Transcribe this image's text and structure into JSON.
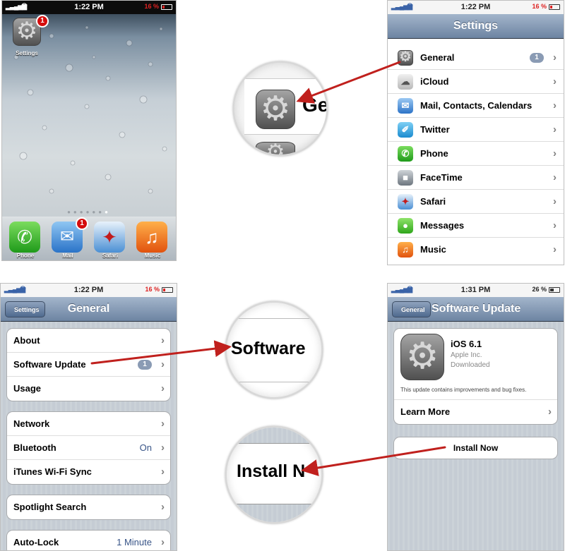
{
  "panel1": {
    "status": {
      "time": "1:22 PM",
      "battery": "16 %"
    },
    "settings_label": "Settings",
    "settings_badge": "1",
    "dock": [
      {
        "label": "Phone",
        "badge": ""
      },
      {
        "label": "Mail",
        "badge": "1"
      },
      {
        "label": "Safari",
        "badge": ""
      },
      {
        "label": "Music",
        "badge": ""
      }
    ]
  },
  "panel2": {
    "status": {
      "time": "1:22 PM",
      "battery": "16 %"
    },
    "title": "Settings",
    "rows": [
      {
        "label": "General",
        "icon": "gear-icon",
        "badge": "1"
      },
      {
        "label": "iCloud",
        "icon": "cloud-icon"
      },
      {
        "label": "Mail, Contacts, Calendars",
        "icon": "envelope-icon"
      },
      {
        "label": "Twitter",
        "icon": "twitter-bird-icon"
      },
      {
        "label": "Phone",
        "icon": "phone-icon"
      },
      {
        "label": "FaceTime",
        "icon": "camera-icon"
      },
      {
        "label": "Safari",
        "icon": "compass-icon"
      },
      {
        "label": "Messages",
        "icon": "speech-bubble-icon"
      },
      {
        "label": "Music",
        "icon": "music-note-icon"
      }
    ]
  },
  "magnifier1": {
    "text": "Ge"
  },
  "panel3": {
    "status": {
      "time": "1:22 PM",
      "battery": "16 %"
    },
    "back": "Settings",
    "title": "General",
    "groups": [
      [
        {
          "label": "About"
        },
        {
          "label": "Software Update",
          "badge": "1"
        },
        {
          "label": "Usage"
        }
      ],
      [
        {
          "label": "Network"
        },
        {
          "label": "Bluetooth",
          "value": "On"
        },
        {
          "label": "iTunes Wi-Fi Sync"
        }
      ],
      [
        {
          "label": "Spotlight Search"
        }
      ],
      [
        {
          "label": "Auto-Lock",
          "value": "1 Minute"
        }
      ]
    ]
  },
  "magnifier2": {
    "text": "Software"
  },
  "panel4": {
    "status": {
      "time": "1:31 PM",
      "battery": "26 %"
    },
    "back": "General",
    "title": "Software Update",
    "update": {
      "name": "iOS 6.1",
      "vendor": "Apple Inc.",
      "state": "Downloaded",
      "description": "This update contains improvements and bug fixes."
    },
    "learn_more": "Learn More",
    "install": "Install Now"
  },
  "magnifier3": {
    "text": "Install N"
  },
  "colors": {
    "nav_top": "#a3b5cb",
    "nav_bottom": "#6d84a2",
    "arrow": "#c0201d",
    "value_blue": "#385487",
    "badge_blue": "#8a9bb4"
  }
}
